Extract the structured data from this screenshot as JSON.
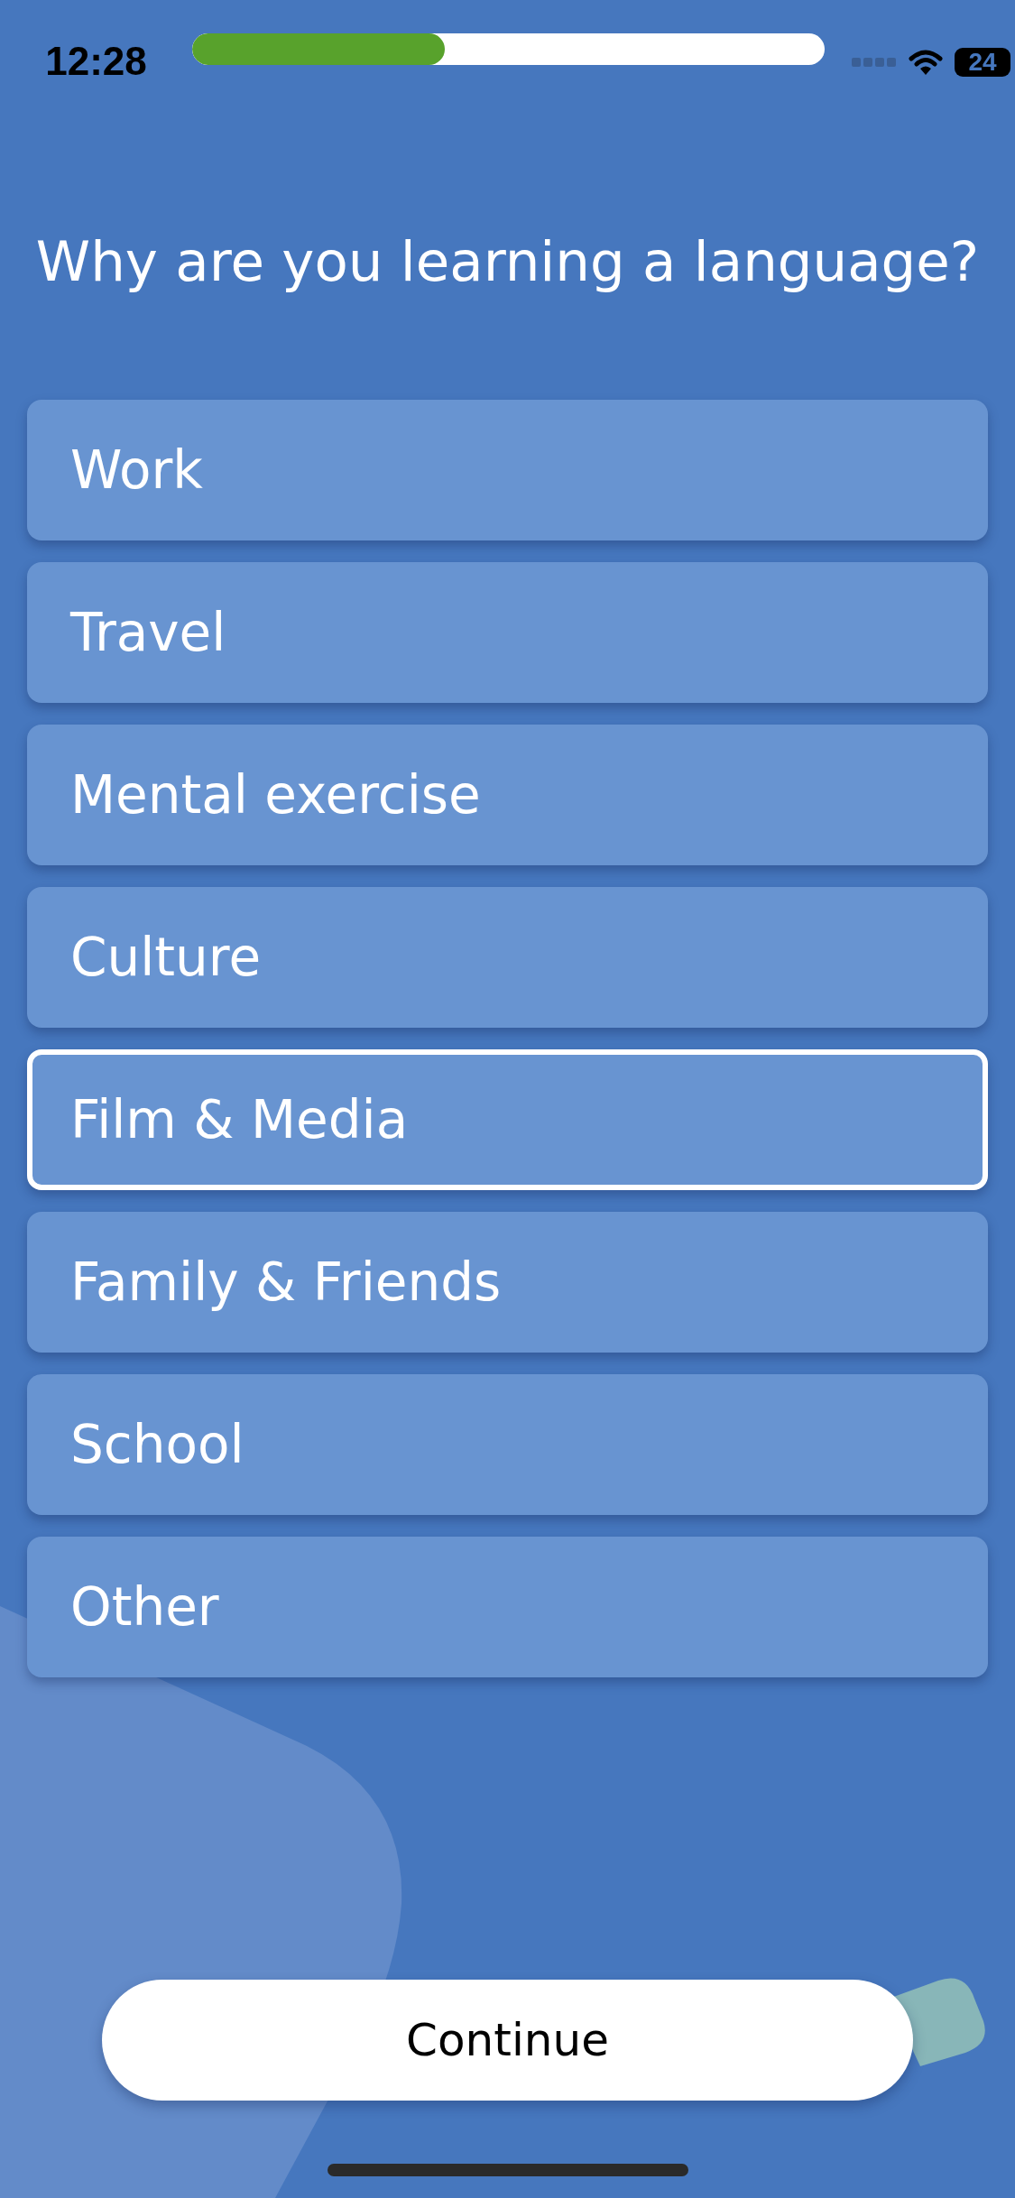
{
  "status_bar": {
    "time": "12:28",
    "battery": "24"
  },
  "progress": {
    "level": 0.4
  },
  "question": "Why are you learning a language?",
  "options": [
    {
      "label": "Work",
      "selected": false
    },
    {
      "label": "Travel",
      "selected": false
    },
    {
      "label": "Mental exercise",
      "selected": false
    },
    {
      "label": "Culture",
      "selected": false
    },
    {
      "label": "Film & Media",
      "selected": true
    },
    {
      "label": "Family & Friends",
      "selected": false
    },
    {
      "label": "School",
      "selected": false
    },
    {
      "label": "Other",
      "selected": false
    }
  ],
  "continue_button": {
    "label": "Continue"
  }
}
